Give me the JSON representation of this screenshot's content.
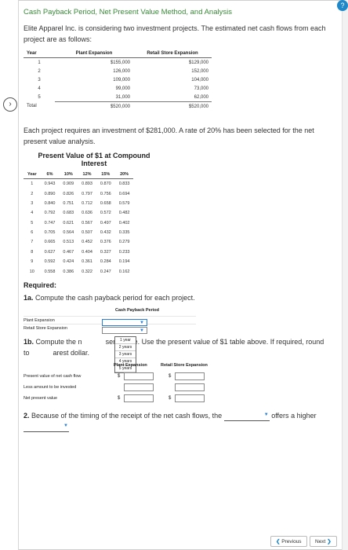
{
  "title": {
    "part1": "Cash Payback Period, Net Present Value Method, and Analysis"
  },
  "intro": "Elite Apparel Inc. is considering two investment projects. The estimated net cash flows from each project are as follows:",
  "cashflow_table": {
    "headers": [
      "Year",
      "Plant Expansion",
      "Retail Store Expansion"
    ],
    "rows": [
      [
        "1",
        "$155,000",
        "$129,000"
      ],
      [
        "2",
        "126,000",
        "152,000"
      ],
      [
        "3",
        "109,000",
        "104,000"
      ],
      [
        "4",
        "99,000",
        "73,000"
      ],
      [
        "5",
        "31,000",
        "62,000"
      ]
    ],
    "total": [
      "Total",
      "$520,000",
      "$520,000"
    ]
  },
  "investment_text": "Each project requires an investment of $281,000. A rate of 20% has been selected for the net present value analysis.",
  "pv_title_line1": "Present Value of $1 at Compound",
  "pv_title_line2": "Interest",
  "pv_table": {
    "headers": [
      "Year",
      "6%",
      "10%",
      "12%",
      "15%",
      "20%"
    ],
    "rows": [
      [
        "1",
        "0.943",
        "0.909",
        "0.893",
        "0.870",
        "0.833"
      ],
      [
        "2",
        "0.890",
        "0.826",
        "0.797",
        "0.756",
        "0.694"
      ],
      [
        "3",
        "0.840",
        "0.751",
        "0.712",
        "0.658",
        "0.579"
      ],
      [
        "4",
        "0.792",
        "0.683",
        "0.636",
        "0.572",
        "0.482"
      ],
      [
        "5",
        "0.747",
        "0.621",
        "0.567",
        "0.497",
        "0.402"
      ],
      [
        "6",
        "0.705",
        "0.564",
        "0.507",
        "0.432",
        "0.335"
      ],
      [
        "7",
        "0.665",
        "0.513",
        "0.452",
        "0.376",
        "0.279"
      ],
      [
        "8",
        "0.627",
        "0.467",
        "0.404",
        "0.327",
        "0.233"
      ],
      [
        "9",
        "0.592",
        "0.424",
        "0.361",
        "0.284",
        "0.194"
      ],
      [
        "10",
        "0.558",
        "0.386",
        "0.322",
        "0.247",
        "0.162"
      ]
    ]
  },
  "required_label": "Required:",
  "q1a": {
    "num": "1a.",
    "text": "Compute the cash payback period for each project."
  },
  "payback": {
    "header": "Cash Payback Period",
    "row1": "Plant Expansion",
    "row2": "Retail Store Expansion",
    "options": [
      "1 year",
      "2 years",
      "3 years",
      "4 years",
      "5 years"
    ]
  },
  "q1b": {
    "num": "1b.",
    "text_a": "Compute the n",
    "text_b": "sent value. Use the present value of $1 table above. If required, round to",
    "text_c": "arest dollar."
  },
  "npv": {
    "col1": "Plant Expansion",
    "col2": "Retail Store Expansion",
    "rows": [
      "Present value of net cash flow",
      "Less amount to be invested",
      "Net present value"
    ],
    "currency": "$"
  },
  "q2": {
    "num": "2.",
    "text_a": "Because of the timing of the receipt of the net cash flows, the",
    "text_b": "offers",
    "text_c": "a higher"
  },
  "nav": {
    "prev": "Previous",
    "next": "Next"
  },
  "icons": {
    "rail": "chevron-right-icon",
    "prev": "chevron-left-icon",
    "next": "chevron-right-icon"
  },
  "colors": {
    "accent": "#1e88c9",
    "title_green": "#3a8a3a"
  }
}
